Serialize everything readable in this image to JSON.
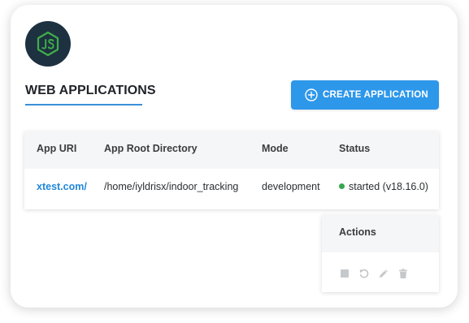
{
  "section": {
    "title": "WEB APPLICATIONS",
    "logo_icon": "nodejs-logo-icon"
  },
  "toolbar": {
    "create_label": "CREATE APPLICATION",
    "create_icon": "plus-circle-icon"
  },
  "table": {
    "columns": [
      "App URI",
      "App Root Directory",
      "Mode",
      "Status"
    ],
    "rows": [
      {
        "uri": "xtest.com/",
        "root": "/home/iyldrisx/indoor_tracking",
        "mode": "development",
        "status": "started (v18.16.0)"
      }
    ]
  },
  "actions": {
    "header": "Actions",
    "icons": [
      "stop-icon",
      "restart-icon",
      "edit-icon",
      "delete-icon"
    ]
  },
  "colors": {
    "accent": "#2d97ea",
    "link": "#2188d9",
    "status_ok": "#36a64f",
    "logo_bg": "#1d3141",
    "logo_green": "#3fae49"
  }
}
